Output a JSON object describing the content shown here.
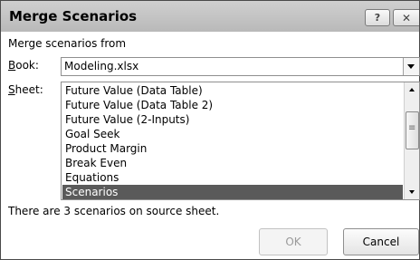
{
  "dialog": {
    "title": "Merge Scenarios",
    "help_label": "?",
    "close_label": "✕"
  },
  "merge_from_label": "Merge scenarios from",
  "book": {
    "label_prefix": "B",
    "label_rest": "ook:",
    "value": "Modeling.xlsx"
  },
  "sheet": {
    "label_prefix": "S",
    "label_rest": "heet:",
    "items": [
      "Future Value (Data Table)",
      "Future Value (Data Table 2)",
      "Future Value (2-Inputs)",
      "Goal Seek",
      "Product Margin",
      "Break Even",
      "Equations",
      "Scenarios"
    ],
    "selected": "Scenarios"
  },
  "status_text": "There are 3 scenarios on source sheet.",
  "buttons": {
    "ok": "OK",
    "cancel": "Cancel"
  }
}
